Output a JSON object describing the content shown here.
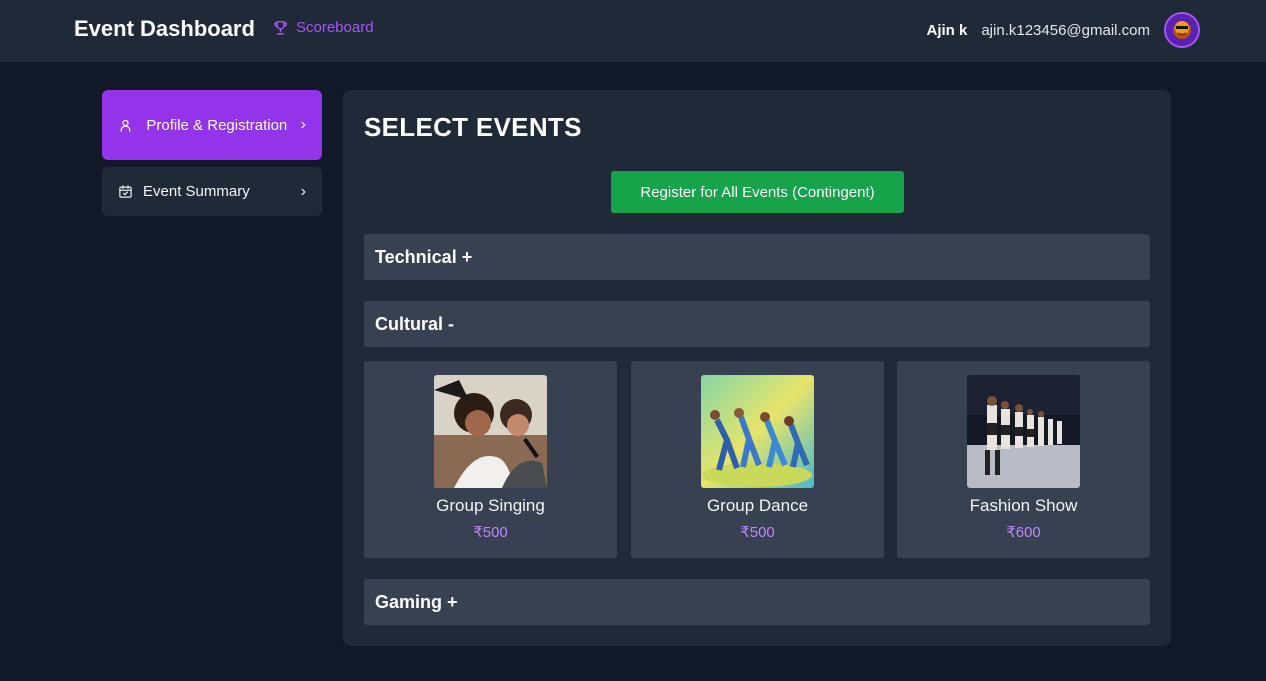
{
  "header": {
    "title": "Event Dashboard",
    "scoreboard_label": "Scoreboard",
    "user_name": "Ajin k",
    "user_email": "ajin.k123456@gmail.com"
  },
  "sidebar": {
    "items": [
      {
        "label": "Profile & Registration",
        "icon": "user-icon",
        "active": true
      },
      {
        "label": "Event Summary",
        "icon": "calendar-check-icon",
        "active": false
      }
    ]
  },
  "main": {
    "title": "SELECT EVENTS",
    "register_all_label": "Register for All Events (Contingent)",
    "categories": [
      {
        "label": "Technical +",
        "expanded": false
      },
      {
        "label": "Cultural -",
        "expanded": true
      },
      {
        "label": "Gaming +",
        "expanded": false
      }
    ],
    "events": [
      {
        "name": "Group Singing",
        "price": "₹500"
      },
      {
        "name": "Group Dance",
        "price": "₹500"
      },
      {
        "name": "Fashion Show",
        "price": "₹600"
      }
    ]
  },
  "colors": {
    "background": "#111827",
    "surface": "#1f2937",
    "accent": "#9333ea",
    "success": "#16a34a",
    "price": "#c084fc"
  }
}
